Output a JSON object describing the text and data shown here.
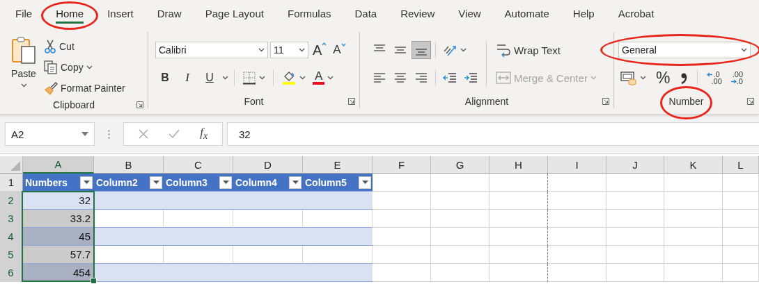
{
  "tabs": [
    {
      "label": "File",
      "selected": false,
      "circled": false
    },
    {
      "label": "Home",
      "selected": true,
      "circled": true
    },
    {
      "label": "Insert",
      "selected": false,
      "circled": false
    },
    {
      "label": "Draw",
      "selected": false,
      "circled": false
    },
    {
      "label": "Page Layout",
      "selected": false,
      "circled": false
    },
    {
      "label": "Formulas",
      "selected": false,
      "circled": false
    },
    {
      "label": "Data",
      "selected": false,
      "circled": false
    },
    {
      "label": "Review",
      "selected": false,
      "circled": false
    },
    {
      "label": "View",
      "selected": false,
      "circled": false
    },
    {
      "label": "Automate",
      "selected": false,
      "circled": false
    },
    {
      "label": "Help",
      "selected": false,
      "circled": false
    },
    {
      "label": "Acrobat",
      "selected": false,
      "circled": false
    }
  ],
  "ribbon": {
    "clipboard": {
      "label": "Clipboard",
      "paste": "Paste",
      "cut": "Cut",
      "copy": "Copy",
      "format_painter": "Format Painter"
    },
    "font": {
      "label": "Font",
      "font_name": "Calibri",
      "font_size": "11",
      "grow": "A",
      "shrink": "A",
      "bold": "B",
      "italic": "I",
      "underline": "U",
      "font_color": "A"
    },
    "alignment": {
      "label": "Alignment",
      "align_buttons": [
        {
          "kind": "top",
          "selected": false
        },
        {
          "kind": "middle",
          "selected": false
        },
        {
          "kind": "bottom",
          "selected": true
        },
        {
          "kind": "left",
          "selected": false
        },
        {
          "kind": "center",
          "selected": false
        },
        {
          "kind": "right",
          "selected": false
        }
      ],
      "wrap_text": "Wrap Text",
      "merge_center": {
        "label": "Merge & Center",
        "disabled": true
      }
    },
    "number": {
      "label": "Number",
      "label_circled": true,
      "format": "General",
      "format_circled": true,
      "percent": "%",
      "decimal_buttons": [
        {
          "kind": "increase",
          "top": ".0",
          "bottom": ".00"
        },
        {
          "kind": "decrease",
          "top": ".00",
          "bottom": ".0"
        }
      ]
    }
  },
  "formula_bar": {
    "name_box": "A2",
    "function_label": "f$_{x}$",
    "value": "32"
  },
  "sheet": {
    "columns": [
      {
        "label": "A",
        "selected": true,
        "page_break_after": false
      },
      {
        "label": "B",
        "selected": false,
        "page_break_after": false
      },
      {
        "label": "C",
        "selected": false,
        "page_break_after": false
      },
      {
        "label": "D",
        "selected": false,
        "page_break_after": false
      },
      {
        "label": "E",
        "selected": false,
        "page_break_after": false
      },
      {
        "label": "F",
        "selected": false,
        "page_break_after": false
      },
      {
        "label": "G",
        "selected": false,
        "page_break_after": false
      },
      {
        "label": "H",
        "selected": false,
        "page_break_after": true
      },
      {
        "label": "I",
        "selected": false,
        "page_break_after": false
      },
      {
        "label": "J",
        "selected": false,
        "page_break_after": false
      },
      {
        "label": "K",
        "selected": false,
        "page_break_after": false
      },
      {
        "label": "L",
        "selected": false,
        "page_break_after": false
      }
    ],
    "rows": [
      {
        "label": "1",
        "selected": false
      },
      {
        "label": "2",
        "selected": true
      },
      {
        "label": "3",
        "selected": true
      },
      {
        "label": "4",
        "selected": true
      },
      {
        "label": "5",
        "selected": true
      },
      {
        "label": "6",
        "selected": true
      }
    ],
    "table": {
      "banded_rows": true,
      "headers": [
        "Numbers",
        "Column2",
        "Column3",
        "Column4",
        "Column5"
      ],
      "cells": [
        {
          "value": "32",
          "selected": true,
          "active": true
        },
        {
          "value": "33.2",
          "selected": true,
          "active": false
        },
        {
          "value": "45",
          "selected": true,
          "active": false
        },
        {
          "value": "57.7",
          "selected": true,
          "active": false
        },
        {
          "value": "454",
          "selected": true,
          "active": false
        }
      ]
    }
  }
}
